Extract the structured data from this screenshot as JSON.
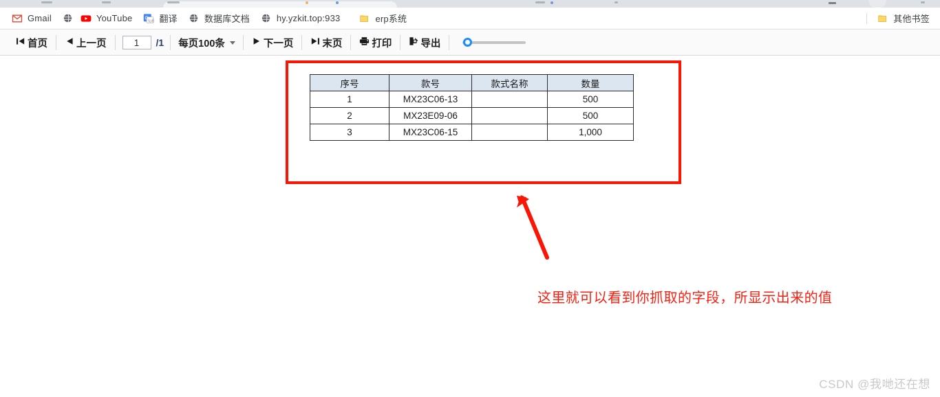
{
  "browser": {
    "bookmarks": [
      {
        "label": "Gmail",
        "icon": "gmail-icon"
      },
      {
        "label": "YouTube",
        "icon": "youtube-icon",
        "leading_icon": "globe-icon"
      },
      {
        "label": "翻译",
        "icon": "translate-icon"
      },
      {
        "label": "数据库文档",
        "icon": "globe-icon"
      },
      {
        "label": "hy.yzkit.top:933",
        "icon": "globe-icon"
      },
      {
        "label": "erp系统",
        "icon": "folder-icon"
      }
    ],
    "other_bookmarks": {
      "label": "其他书签",
      "icon": "folder-icon"
    }
  },
  "toolbar": {
    "first_page": {
      "label": "首页",
      "icon": "first-page-icon"
    },
    "prev_page": {
      "label": "上一页",
      "icon": "prev-page-icon"
    },
    "page_input": {
      "value": "1",
      "placeholder": ""
    },
    "page_total": "/1",
    "page_size": {
      "label": "每页100条",
      "icon": "chevron-down-icon"
    },
    "next_page": {
      "label": "下一页",
      "icon": "next-page-icon"
    },
    "last_page": {
      "label": "末页",
      "icon": "last-page-icon"
    },
    "print": {
      "label": "打印",
      "icon": "printer-icon"
    },
    "export": {
      "label": "导出",
      "icon": "export-icon"
    },
    "zoom_slider": {
      "value": 5,
      "min": 0,
      "max": 100,
      "accent": "#1a8cff"
    }
  },
  "report": {
    "table": {
      "headers": [
        "序号",
        "款号",
        "款式名称",
        "数量"
      ],
      "rows": [
        [
          "1",
          "MX23C06-13",
          "",
          "500"
        ],
        [
          "2",
          "MX23E09-06",
          "",
          "500"
        ],
        [
          "3",
          "MX23C06-15",
          "",
          "1,000"
        ]
      ],
      "header_bg": "#dce6f1",
      "border_color": "#2b2b2b"
    }
  },
  "annotations": {
    "highlight_box_color": "#fa1605",
    "arrow_color": "#fa1605",
    "note_text": "这里就可以看到你抓取的字段，所显示出来的值",
    "note_color": "#fa2010"
  },
  "watermark": {
    "text": "CSDN @我哋还在想",
    "color": "#c9c9c9"
  }
}
